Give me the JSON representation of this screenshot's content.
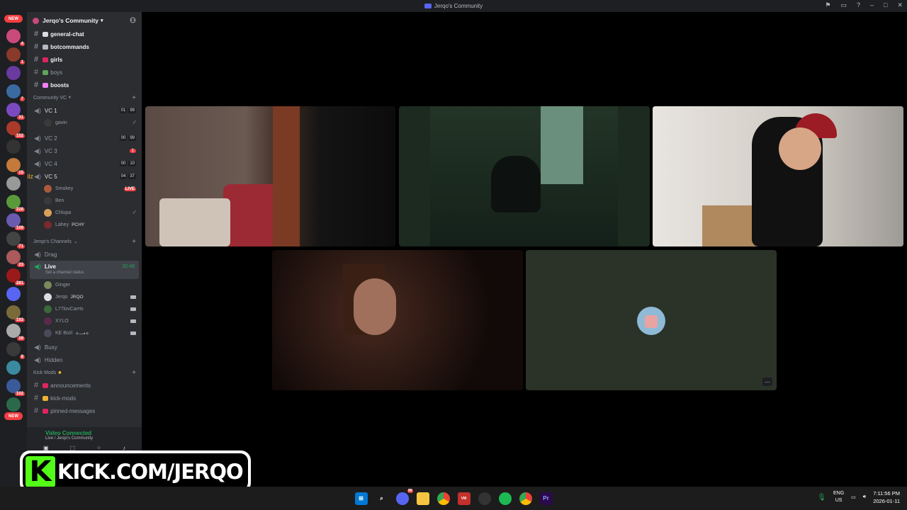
{
  "window": {
    "title": "Jerqo's Community"
  },
  "guilds": {
    "new_label": "NEW",
    "badges": [
      "4",
      "1",
      "",
      "7",
      "31",
      "152",
      "",
      "15",
      "",
      "228",
      "109",
      "71",
      "23",
      "281",
      "",
      "193",
      "19",
      "8",
      "",
      "102",
      ""
    ]
  },
  "server": {
    "name": "Jerqo's Community"
  },
  "channels_top": [
    {
      "name": "general-chat",
      "bold": true,
      "color": "#dbdee1"
    },
    {
      "name": "botcommands",
      "bold": true,
      "color": "#b5bac1"
    },
    {
      "name": "girls",
      "bold": true,
      "color": "#e0245e"
    },
    {
      "name": "boys",
      "bold": false,
      "color": "#5fa55a"
    },
    {
      "name": "boosts",
      "bold": true,
      "color": "#f47fff"
    }
  ],
  "community_vc": {
    "label": "Community VC",
    "vc1": {
      "name": "VC 1",
      "count_a": "01",
      "count_b": "99",
      "user": "gavin"
    },
    "vc2": {
      "name": "VC 2",
      "count_a": "00",
      "count_b": "99"
    },
    "vc3": {
      "name": "VC 3",
      "count": "1"
    },
    "vc4": {
      "name": "VC 4",
      "count_a": "00",
      "count_b": "10"
    },
    "vc5": {
      "name": "VC 5",
      "count_a": "04",
      "count_b": "37",
      "overlay": "dmilz"
    },
    "vc5_users": [
      {
        "name": "Smokey",
        "live": "LIVE"
      },
      {
        "name": "Ben"
      },
      {
        "name": "Chlupa"
      },
      {
        "name": "Lahey",
        "tag": "PCHY"
      }
    ]
  },
  "jerqo_channels": {
    "label": "Jerqo's Channels",
    "drag": "Drag",
    "live": {
      "name": "Live",
      "timer": "32:48",
      "status": "Set a channel status"
    },
    "live_users": [
      {
        "name": "Ginger"
      },
      {
        "name": "Jerqo",
        "tag": "JRQO"
      },
      {
        "name": "L77lovCarrts"
      },
      {
        "name": "XYLO"
      },
      {
        "name": "KE Bizil",
        "tag": "✧—•✧"
      }
    ],
    "busy": "Busy",
    "hidden": "Hidden"
  },
  "kick_mods": {
    "label": "Kick Mods",
    "channels": [
      "announcements",
      "kick-mods",
      "pinned-messages"
    ]
  },
  "voice_panel": {
    "status": "Video Connected",
    "location": "Live / Jerqo's Community"
  },
  "overlay": {
    "kick_text": "KICK.COM/JERQO"
  },
  "taskbar": {
    "discord_badge": "99",
    "lang_a": "ENG",
    "lang_b": "US",
    "time": "7:11:56 PM",
    "date": "2026-01-11"
  }
}
